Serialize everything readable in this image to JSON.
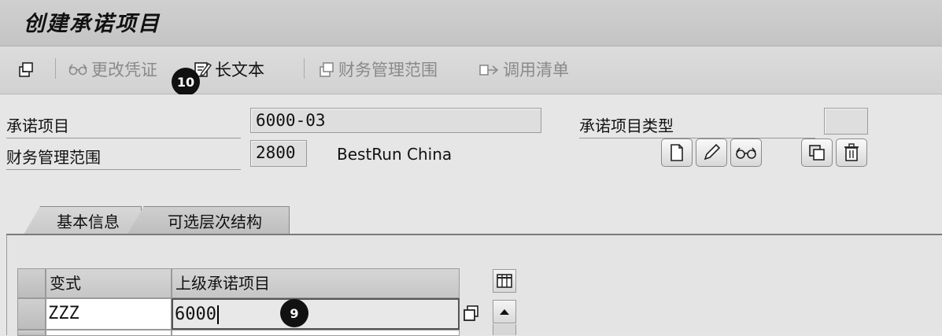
{
  "window": {
    "title": "创建承诺项目"
  },
  "toolbar": {
    "change_document": "更改凭证",
    "long_text": "长文本",
    "fm_area": "财务管理范围",
    "where_used": "调用清单"
  },
  "badges": {
    "toolbar_badge": "10",
    "grid_badge": "9"
  },
  "header": {
    "commitment_item_label": "承诺项目",
    "commitment_item_value": "6000-03",
    "commitment_item_type_label": "承诺项目类型",
    "commitment_item_type_value": "",
    "fm_area_label": "财务管理范围",
    "fm_area_value": "2800",
    "fm_area_description": "BestRun China"
  },
  "tabs": [
    {
      "label": "基本信息",
      "active": false
    },
    {
      "label": "可选层次结构",
      "active": true
    }
  ],
  "grid": {
    "columns": [
      "变式",
      "上级承诺项目"
    ],
    "rows": [
      {
        "variant": "ZZZ",
        "parent_item": "6000"
      }
    ]
  },
  "icons": {
    "toolbar": [
      "other-object-icon",
      "glasses-icon",
      "long-text-icon",
      "fm-area-icon",
      "where-used-icon"
    ],
    "header_buttons": [
      "create-icon",
      "change-icon",
      "display-icon",
      "copy-icon",
      "delete-icon"
    ]
  }
}
